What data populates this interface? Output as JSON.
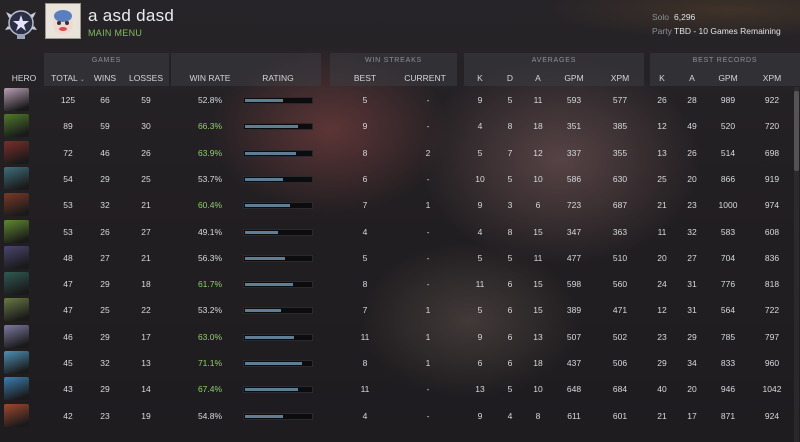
{
  "player": {
    "name": "a asd dasd",
    "menu_label": "MAIN MENU"
  },
  "mmr": {
    "solo_label": "Solo",
    "solo_value": "6,296",
    "party_label": "Party",
    "party_value": "TBD - 10 Games Remaining"
  },
  "groups": {
    "games": "GAMES",
    "streaks": "WIN STREAKS",
    "averages": "AVERAGES",
    "records": "BEST RECORDS"
  },
  "columns": {
    "hero": "HERO",
    "total": "TOTAL",
    "wins": "WINS",
    "losses": "LOSSES",
    "win_rate": "WIN RATE",
    "rating": "RATING",
    "best": "BEST",
    "current": "CURRENT",
    "k": "K",
    "d": "D",
    "a": "A",
    "gpm": "GPM",
    "xpm": "XPM",
    "rk": "K",
    "ra": "A",
    "rgpm": "GPM",
    "rxpm": "XPM",
    "sort_arrow": "⌄"
  },
  "rows": [
    {
      "hero": "hero-1",
      "total": "125",
      "wins": "66",
      "losses": "59",
      "win_rate": "52.8%",
      "rating": 0.58,
      "best": "5",
      "current": "-",
      "k": "9",
      "d": "5",
      "a": "11",
      "gpm": "593",
      "xpm": "577",
      "rk": "26",
      "ra": "28",
      "rgpm": "989",
      "rxpm": "922"
    },
    {
      "hero": "hero-2",
      "total": "89",
      "wins": "59",
      "losses": "30",
      "win_rate": "66.3%",
      "rating": 0.8,
      "best": "9",
      "current": "-",
      "k": "4",
      "d": "8",
      "a": "18",
      "gpm": "351",
      "xpm": "385",
      "rk": "12",
      "ra": "49",
      "rgpm": "520",
      "rxpm": "720"
    },
    {
      "hero": "hero-3",
      "total": "72",
      "wins": "46",
      "losses": "26",
      "win_rate": "63.9%",
      "rating": 0.78,
      "best": "8",
      "current": "2",
      "k": "5",
      "d": "7",
      "a": "12",
      "gpm": "337",
      "xpm": "355",
      "rk": "13",
      "ra": "26",
      "rgpm": "514",
      "rxpm": "698"
    },
    {
      "hero": "hero-4",
      "total": "54",
      "wins": "29",
      "losses": "25",
      "win_rate": "53.7%",
      "rating": 0.57,
      "best": "6",
      "current": "-",
      "k": "10",
      "d": "5",
      "a": "10",
      "gpm": "586",
      "xpm": "630",
      "rk": "25",
      "ra": "20",
      "rgpm": "866",
      "rxpm": "919"
    },
    {
      "hero": "hero-5",
      "total": "53",
      "wins": "32",
      "losses": "21",
      "win_rate": "60.4%",
      "rating": 0.68,
      "best": "7",
      "current": "1",
      "k": "9",
      "d": "3",
      "a": "6",
      "gpm": "723",
      "xpm": "687",
      "rk": "21",
      "ra": "23",
      "rgpm": "1000",
      "rxpm": "974"
    },
    {
      "hero": "hero-6",
      "total": "53",
      "wins": "26",
      "losses": "27",
      "win_rate": "49.1%",
      "rating": 0.5,
      "best": "4",
      "current": "-",
      "k": "4",
      "d": "8",
      "a": "15",
      "gpm": "347",
      "xpm": "363",
      "rk": "11",
      "ra": "32",
      "rgpm": "583",
      "rxpm": "608"
    },
    {
      "hero": "hero-7",
      "total": "48",
      "wins": "27",
      "losses": "21",
      "win_rate": "56.3%",
      "rating": 0.6,
      "best": "5",
      "current": "-",
      "k": "5",
      "d": "5",
      "a": "11",
      "gpm": "477",
      "xpm": "510",
      "rk": "20",
      "ra": "27",
      "rgpm": "704",
      "rxpm": "836"
    },
    {
      "hero": "hero-8",
      "total": "47",
      "wins": "29",
      "losses": "18",
      "win_rate": "61.7%",
      "rating": 0.72,
      "best": "8",
      "current": "-",
      "k": "11",
      "d": "6",
      "a": "15",
      "gpm": "598",
      "xpm": "560",
      "rk": "24",
      "ra": "31",
      "rgpm": "776",
      "rxpm": "818"
    },
    {
      "hero": "hero-9",
      "total": "47",
      "wins": "25",
      "losses": "22",
      "win_rate": "53.2%",
      "rating": 0.55,
      "best": "7",
      "current": "1",
      "k": "5",
      "d": "6",
      "a": "15",
      "gpm": "389",
      "xpm": "471",
      "rk": "12",
      "ra": "31",
      "rgpm": "564",
      "rxpm": "722"
    },
    {
      "hero": "hero-10",
      "total": "46",
      "wins": "29",
      "losses": "17",
      "win_rate": "63.0%",
      "rating": 0.74,
      "best": "11",
      "current": "1",
      "k": "9",
      "d": "6",
      "a": "13",
      "gpm": "507",
      "xpm": "502",
      "rk": "23",
      "ra": "29",
      "rgpm": "785",
      "rxpm": "797"
    },
    {
      "hero": "hero-11",
      "total": "45",
      "wins": "32",
      "losses": "13",
      "win_rate": "71.1%",
      "rating": 0.86,
      "best": "8",
      "current": "1",
      "k": "6",
      "d": "6",
      "a": "18",
      "gpm": "437",
      "xpm": "506",
      "rk": "29",
      "ra": "34",
      "rgpm": "833",
      "rxpm": "960"
    },
    {
      "hero": "hero-12",
      "total": "43",
      "wins": "29",
      "losses": "14",
      "win_rate": "67.4%",
      "rating": 0.8,
      "best": "11",
      "current": "-",
      "k": "13",
      "d": "5",
      "a": "10",
      "gpm": "648",
      "xpm": "684",
      "rk": "40",
      "ra": "20",
      "rgpm": "946",
      "rxpm": "1042"
    },
    {
      "hero": "hero-13",
      "total": "42",
      "wins": "23",
      "losses": "19",
      "win_rate": "54.8%",
      "rating": 0.58,
      "best": "4",
      "current": "-",
      "k": "9",
      "d": "4",
      "a": "8",
      "gpm": "611",
      "xpm": "601",
      "rk": "21",
      "ra": "17",
      "rgpm": "871",
      "rxpm": "924"
    }
  ],
  "hero_colors": [
    "#b89fb5",
    "#4f7a2c",
    "#7b2e2a",
    "#3d6f7c",
    "#7a3a26",
    "#5f8a30",
    "#4b4570",
    "#2f5a52",
    "#6a7a44",
    "#7d7aa0",
    "#4e8fb5",
    "#3c7fb0",
    "#a04830"
  ],
  "colors": {
    "good_winrate": "#8fcf6c",
    "rating_bar": "#5f7e93",
    "menu_green": "#7fbf5a"
  }
}
